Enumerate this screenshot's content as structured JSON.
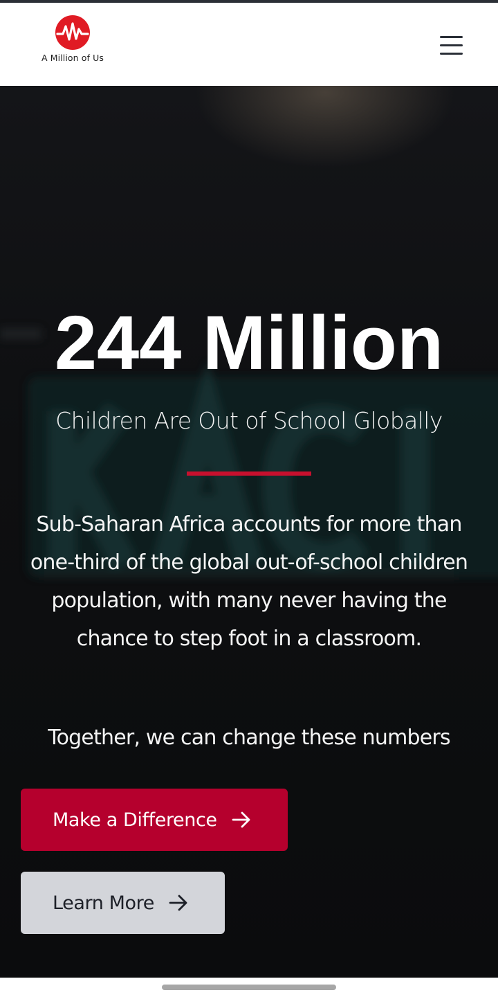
{
  "header": {
    "logo_text": "A Million of Us",
    "logo_icon": "pulse-wave-logo-icon",
    "menu_icon": "hamburger-menu-icon"
  },
  "hero": {
    "stat_number": "244 Million",
    "stat_caption": "Children Are Out of School Globally",
    "paragraph": "Sub-Saharan Africa accounts for more than one-third of the global out-of-school children population, with many never having the chance to step foot in a classroom.",
    "tagline": "Together, we can change these numbers"
  },
  "buttons": {
    "primary_label": "Make a Difference",
    "secondary_label": "Learn More",
    "arrow_icon": "arrow-right-icon"
  },
  "colors": {
    "brand_red": "#c8102e",
    "primary_button": "#b5002d",
    "secondary_button": "#d3d5da",
    "hero_background": "#0e0f11"
  }
}
